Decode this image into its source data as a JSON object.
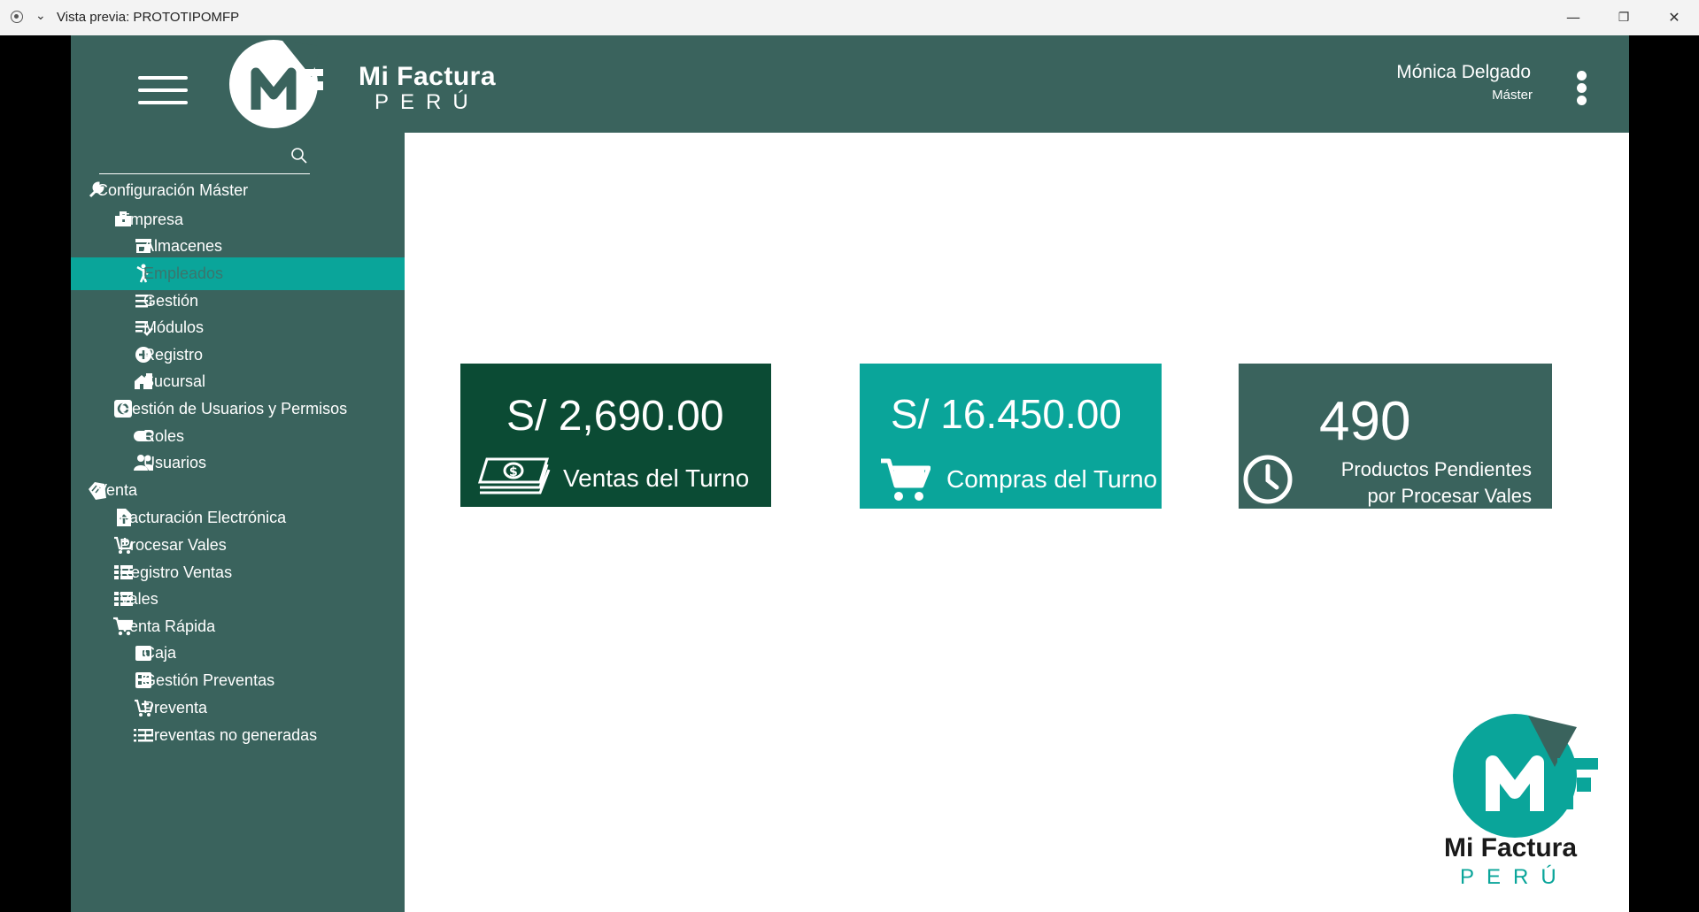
{
  "window": {
    "title": "Vista previa: PROTOTIPOMFP",
    "minimize": "—",
    "restore": "❐",
    "close": "✕"
  },
  "header": {
    "brand_line1": "Mi Factura",
    "brand_line2": "PERÚ",
    "user_name": "Mónica Delgado",
    "user_role": "Máster"
  },
  "search": {
    "placeholder": ""
  },
  "menu": [
    {
      "label": "Configuración Máster",
      "icon": "wrench-icon",
      "level": 0
    },
    {
      "label": "Empresa",
      "icon": "briefcase-icon",
      "level": 1
    },
    {
      "label": "Almacenes",
      "icon": "store-icon",
      "level": 2
    },
    {
      "label": "Empleados",
      "icon": "person-icon",
      "level": 2,
      "selected": true
    },
    {
      "label": "Gestión",
      "icon": "list-settings-icon",
      "level": 2
    },
    {
      "label": "Módulos",
      "icon": "list-check-icon",
      "level": 2
    },
    {
      "label": "Registro",
      "icon": "add-circle-icon",
      "level": 2
    },
    {
      "label": "Sucursal",
      "icon": "home-work-icon",
      "level": 2
    },
    {
      "label": "Gestión de Usuarios y Permisos",
      "icon": "gear-box-icon",
      "level": 1
    },
    {
      "label": "Roles",
      "icon": "toggle-icon",
      "level": 2
    },
    {
      "label": "Usuarios",
      "icon": "people-icon",
      "level": 2
    },
    {
      "label": "Venta",
      "icon": "tag-icon",
      "level": 0
    },
    {
      "label": "Facturación Electrónica",
      "icon": "file-upload-icon",
      "level": 1
    },
    {
      "label": "Procesar Vales",
      "icon": "cart-plus-icon",
      "level": 1
    },
    {
      "label": "Registro Ventas",
      "icon": "table-list-icon",
      "level": 1
    },
    {
      "label": "Vales",
      "icon": "table-list-icon",
      "level": 1
    },
    {
      "label": "Venta Rápida",
      "icon": "cart-icon",
      "level": 1
    },
    {
      "label": "Caja",
      "icon": "wallet-icon",
      "level": 2
    },
    {
      "label": "Gestión Preventas",
      "icon": "ballot-icon",
      "level": 2
    },
    {
      "label": "Preventa",
      "icon": "cart-plus-icon",
      "level": 2
    },
    {
      "label": "Preventas no generadas",
      "icon": "list-icon",
      "level": 2
    }
  ],
  "cards": {
    "ventas": {
      "amount": "S/ 2,690.00",
      "label": "Ventas del Turno",
      "icon": "money-icon",
      "color": "#0b4b34"
    },
    "compras": {
      "amount": "S/ 16.450.00",
      "label": "Compras del Turno",
      "icon": "cart-icon",
      "color": "#0aa59a"
    },
    "pendientes": {
      "count": "490",
      "label_line1": "Productos Pendientes",
      "label_line2": "por Procesar Vales",
      "icon": "clock-icon",
      "color": "#3a635d"
    }
  },
  "footer_logo": {
    "line1": "Mi Factura",
    "line2": "PERÚ"
  },
  "colors": {
    "primary": "#3a635d",
    "accent": "#0aa59a",
    "dark": "#0b4b34"
  }
}
